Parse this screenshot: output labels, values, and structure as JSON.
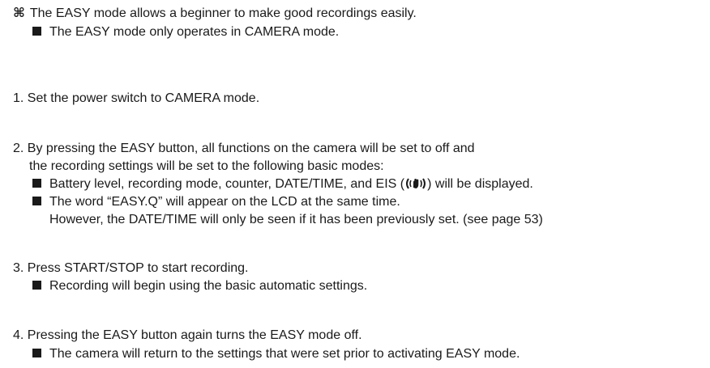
{
  "intro": {
    "note_symbol": "⌘",
    "note_text": "The EASY mode allows a beginner to make good recordings easily.",
    "sub_bullet": "The EASY mode only operates in CAMERA mode."
  },
  "steps": [
    {
      "number": "1.",
      "text": "Set the power switch to CAMERA mode."
    },
    {
      "number": "2.",
      "text_line1": "By pressing the EASY button, all functions on the camera will be set to off and",
      "text_line2": "the recording settings will be set to the following basic modes:",
      "bullet1_before_icon": "Battery level, recording mode, counter, DATE/TIME, and EIS (",
      "bullet1_icon": "eis-hand-shake-icon",
      "bullet1_after_icon": ") will be displayed.",
      "bullet2_line1": "The word “EASY.Q” will appear on the LCD at the same time.",
      "bullet2_line2": "However, the DATE/TIME will only be seen if it has been previously set. (see page 53)"
    },
    {
      "number": "3.",
      "text": "Press START/STOP to start recording.",
      "bullet": "Recording will begin using the basic automatic settings."
    },
    {
      "number": "4.",
      "text": "Pressing the EASY button again turns the EASY mode off.",
      "bullet": "The camera will return to the settings that were set prior to activating EASY mode."
    }
  ]
}
